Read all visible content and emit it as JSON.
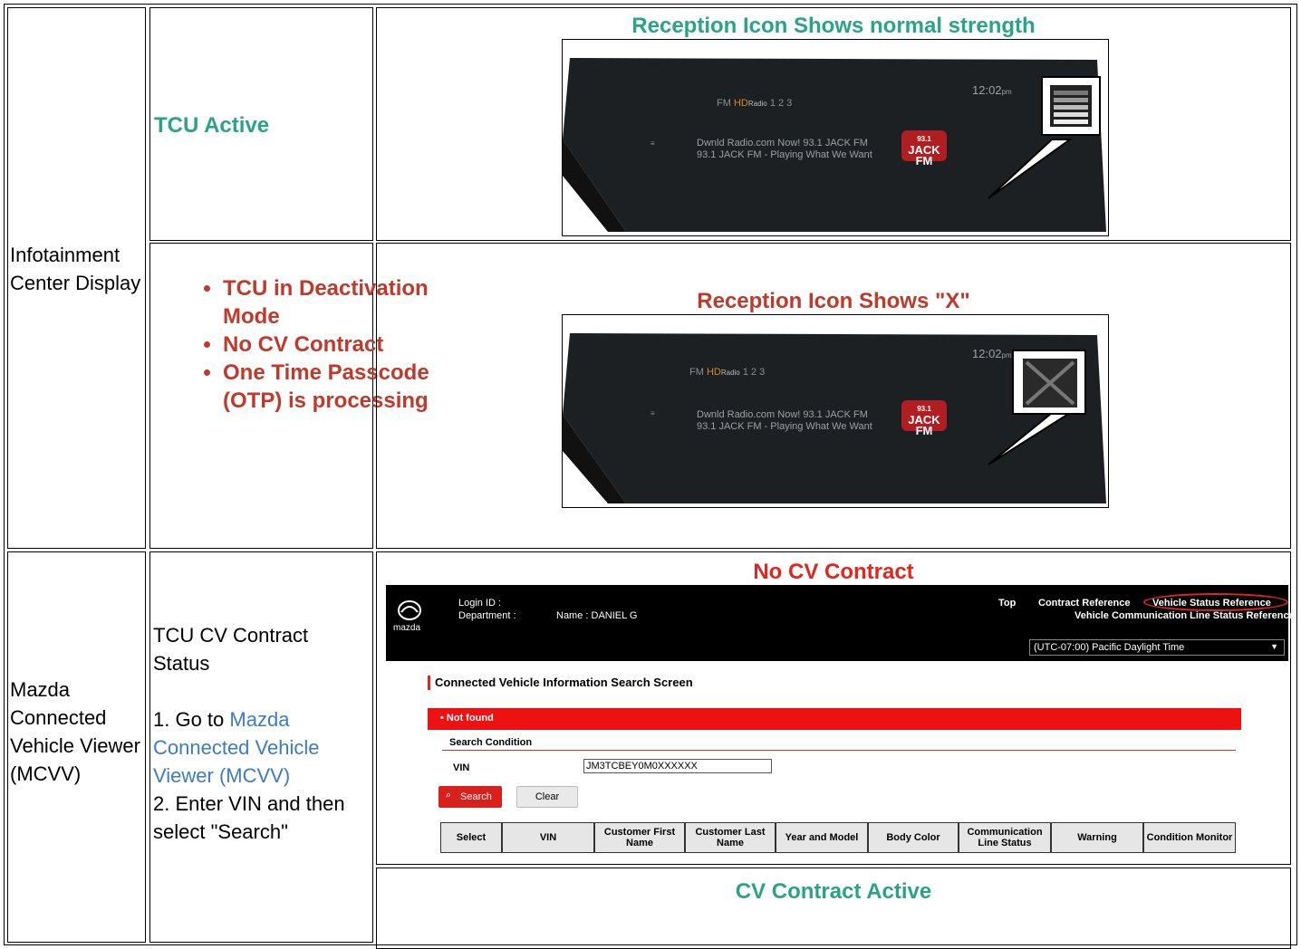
{
  "rows": {
    "infotainment": {
      "label": "Infotainment Center Display",
      "active": {
        "status": "TCU Active",
        "heading": "Reception Icon Shows normal strength"
      },
      "inactive": {
        "status_items": [
          "TCU in Deactivation Mode",
          "No CV Contract",
          "One Time Passcode (OTP) is processing"
        ],
        "heading": "Reception Icon Shows \"X\""
      }
    },
    "mcvv": {
      "label": "Mazda Connected Vehicle Viewer (MCVV)",
      "instructions": {
        "title": "TCU CV Contract Status",
        "step1_prefix": "1. Go to",
        "step1_link": "Mazda Connected Vehicle Viewer (MCVV)",
        "step2": "2. Enter VIN and then select \"Search\""
      },
      "no_contract_heading": "No CV Contract",
      "active_heading": "CV Contract Active"
    }
  },
  "display": {
    "time": "12:02",
    "time_suffix": "pm",
    "band": "FM",
    "hd_label": "HD",
    "radio_label": "Radio",
    "presets": "1 2 3",
    "line1": "Dwnld Radio.com Now!   93.1 JACK FM",
    "line2": "93.1 JACK FM - Playing What We Want",
    "logo_top": "93.1",
    "logo_main": "JACK FM"
  },
  "mcvv_screen": {
    "brand": "mazda",
    "login_label": "Login ID :",
    "department_label": "Department :",
    "name_label": "Name : DANIEL G",
    "nav": {
      "top": "Top",
      "contract_reference": "Contract Reference",
      "vehicle_status_reference": "Vehicle Status Reference",
      "line_status_reference": "Vehicle Communication Line Status Reference"
    },
    "timezone": "(UTC-07:00) Pacific Daylight Time",
    "page_title": "Connected Vehicle Information Search Screen",
    "error": "• Not found",
    "search_condition": "Search Condition",
    "vin_label": "VIN",
    "vin_value": "JM3TCBEY0M0XXXXXX",
    "search_button": "Search",
    "clear_button": "Clear",
    "columns": [
      "Select",
      "VIN",
      "Customer First Name",
      "Customer Last Name",
      "Year and Model",
      "Body Color",
      "Communication Line Status",
      "Warning",
      "Condition Monitor"
    ]
  },
  "colors": {
    "green": "#2aa583",
    "red": "#c0392b",
    "link": "#3b7cc4",
    "error_bar": "#ee1111"
  }
}
